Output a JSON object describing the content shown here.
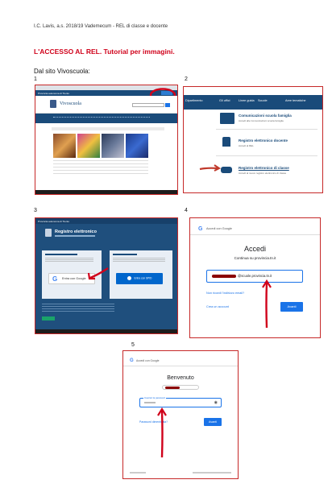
{
  "document": {
    "header": "I.C. Lavis, a.s. 2018/19   Vademecum - REL di classe e docente",
    "title": "L'ACCESSO AL REL. Tutorial per immagini.",
    "subtitle": "Dal sito Vivoscuola:",
    "step_numbers": [
      "1",
      "2",
      "3",
      "4",
      "5"
    ]
  },
  "shot1": {
    "site_name": "Vivoscuola",
    "portal_label": "Provincia autonoma di Trento"
  },
  "shot2": {
    "nav": [
      "Dipartimento",
      "Gli uffici",
      "Linee guida",
      "Scuole",
      "Aree tematiche"
    ],
    "items": [
      {
        "title": "Comunicazioni scuola famiglia",
        "desc": "Accedi alle Comunicazioni scuola famiglia"
      },
      {
        "title": "Registro elettronico docente",
        "desc": "Accedi al REL"
      },
      {
        "title": "Registro elettronico di classe",
        "desc": "Accedi al nuovo registro elettronico di classe"
      }
    ]
  },
  "shot3": {
    "portal_label": "Provincia autonoma di Trento",
    "app_title": "Registro elettronico",
    "google_button": "Entra con Google",
    "spid_button": "Entra con SPID"
  },
  "shot4": {
    "google_label": "Accedi con Google",
    "heading": "Accedi",
    "subheading": "Continua su provincia.tn.it",
    "email_value": "@scuole.provincia.tn.it",
    "forgot_email": "Non ricordi l'indirizzo email?",
    "create_account": "Crea un account",
    "next_button": "Avanti"
  },
  "shot5": {
    "google_label": "Accedi con Google",
    "heading": "Benvenuto",
    "password_label": "Inserisci la password",
    "forgot_password": "Password dimenticata?",
    "next_button": "Avanti"
  },
  "colors": {
    "title_red": "#d0021b",
    "frame_red": "#c62828",
    "portal_blue": "#1a4b7a",
    "google_blue": "#1a73e8"
  }
}
